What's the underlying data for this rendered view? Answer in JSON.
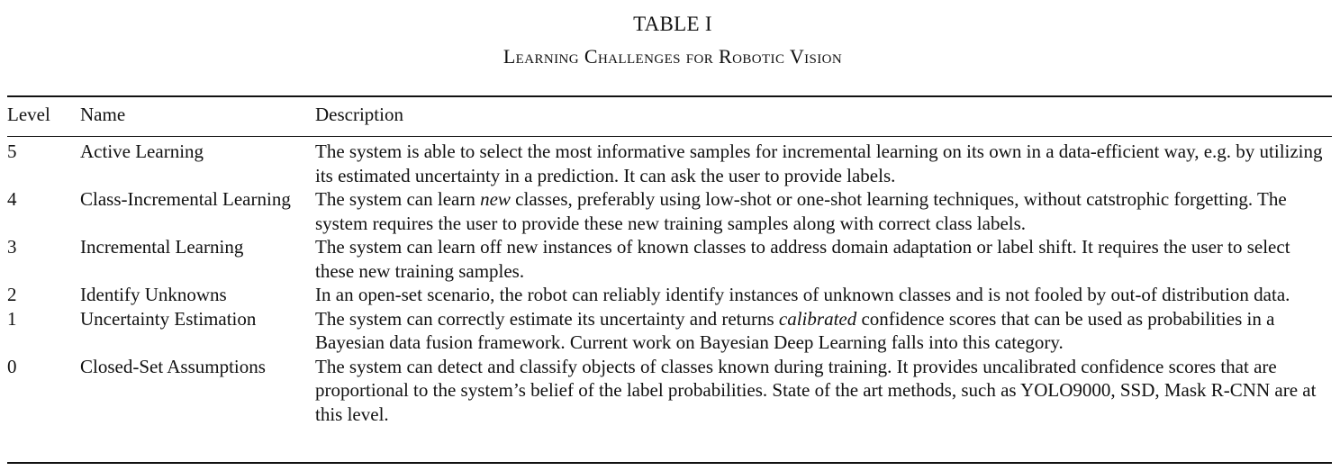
{
  "caption": {
    "number": "TABLE I",
    "title": "Learning Challenges for Robotic Vision"
  },
  "table": {
    "headers": {
      "level": "Level",
      "name": "Name",
      "description": "Description"
    },
    "rows": [
      {
        "level": "5",
        "name": "Active Learning",
        "description": [
          {
            "text": "The system is able to select the most informative samples for incremental learning on its own in a data-efficient way, e.g. by utilizing its estimated uncertainty in a prediction. It can ask the user to provide labels.",
            "style": "normal"
          }
        ]
      },
      {
        "level": "4",
        "name": "Class-Incremental Learning",
        "description": [
          {
            "text": "The system can learn ",
            "style": "normal"
          },
          {
            "text": "new",
            "style": "italic"
          },
          {
            "text": " classes, preferably using low-shot or one-shot learning techniques, without catstrophic forgetting. The system requires the user to provide these new training samples along with correct class labels.",
            "style": "normal"
          }
        ]
      },
      {
        "level": "3",
        "name": "Incremental Learning",
        "description": [
          {
            "text": "The system can learn off new instances of known classes to address domain adaptation or label shift. It requires the user to select these new training samples.",
            "style": "normal"
          }
        ]
      },
      {
        "level": "2",
        "name": "Identify Unknowns",
        "description": [
          {
            "text": "In an open-set scenario, the robot can reliably identify instances of unknown classes and is not fooled by out-of distribution data.",
            "style": "normal"
          }
        ]
      },
      {
        "level": "1",
        "name": "Uncertainty Estimation",
        "description": [
          {
            "text": "The system can correctly estimate its uncertainty and returns ",
            "style": "normal"
          },
          {
            "text": "calibrated",
            "style": "italic"
          },
          {
            "text": " confidence scores that can be used as probabilities in a Bayesian data fusion framework. Current work on Bayesian Deep Learning falls into this category.",
            "style": "normal"
          }
        ]
      },
      {
        "level": "0",
        "name": "Closed-Set Assumptions",
        "description": [
          {
            "text": "The system can detect and classify objects of classes known during training. It provides uncalibrated confidence scores that are proportional to the system’s belief of the label probabilities. State of the art methods, such as YOLO9000, SSD, Mask R-CNN are at this level.",
            "style": "normal"
          }
        ]
      }
    ]
  }
}
